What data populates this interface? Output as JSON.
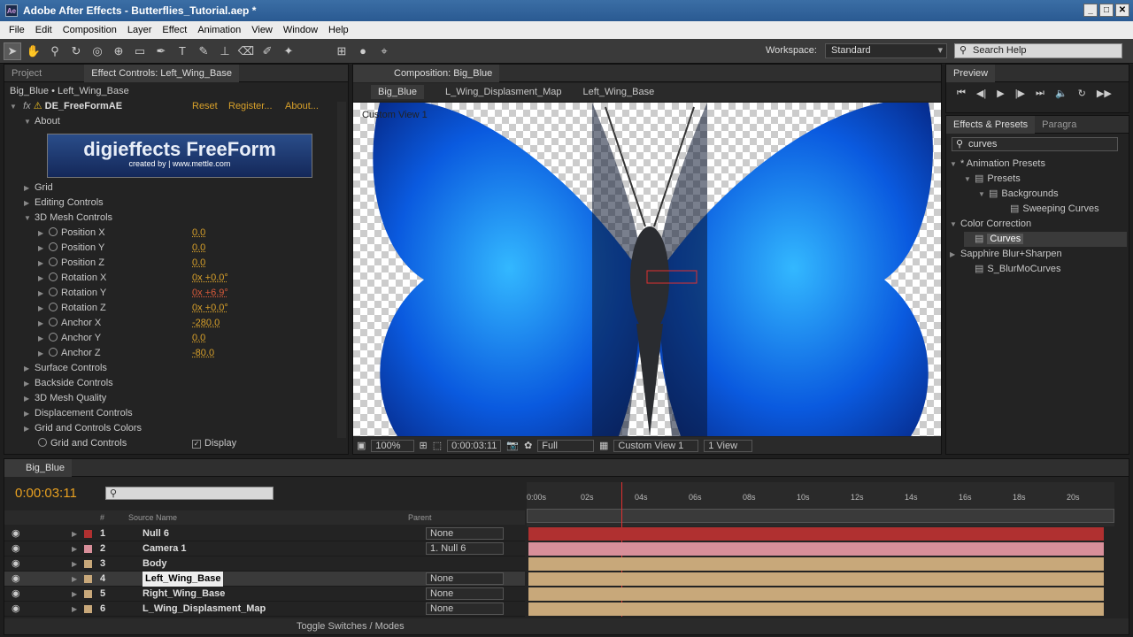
{
  "window": {
    "title": "Adobe After Effects - Butterflies_Tutorial.aep *"
  },
  "menu": [
    "File",
    "Edit",
    "Composition",
    "Layer",
    "Effect",
    "Animation",
    "View",
    "Window",
    "Help"
  ],
  "toolbar": {
    "workspace_label": "Workspace:",
    "workspace_value": "Standard",
    "search_placeholder": "Search Help"
  },
  "left_panel": {
    "tabs": [
      "Project",
      "Effect Controls: Left_Wing_Base"
    ],
    "breadcrumb": "Big_Blue • Left_Wing_Base",
    "effect_name": "DE_FreeFormAE",
    "reset": "Reset",
    "register": "Register...",
    "about_link": "About...",
    "about": "About",
    "banner_title": "digieffects FreeForm",
    "banner_sub": "created by | www.mettle.com",
    "sections": [
      "Grid",
      "Editing Controls",
      "3D Mesh Controls"
    ],
    "params": [
      {
        "name": "Position X",
        "value": "0.0",
        "red": false
      },
      {
        "name": "Position Y",
        "value": "0.0",
        "red": false
      },
      {
        "name": "Position Z",
        "value": "0.0",
        "red": false
      },
      {
        "name": "Rotation X",
        "value": "0x +0.0°",
        "red": false
      },
      {
        "name": "Rotation Y",
        "value": "0x +6.9°",
        "red": true
      },
      {
        "name": "Rotation Z",
        "value": "0x +0.0°",
        "red": false
      },
      {
        "name": "Anchor X",
        "value": "-280.0",
        "red": false
      },
      {
        "name": "Anchor Y",
        "value": "0.0",
        "red": false
      },
      {
        "name": "Anchor Z",
        "value": "-80.0",
        "red": false
      }
    ],
    "sections2": [
      "Surface Controls",
      "Backside Controls",
      "3D Mesh Quality",
      "Displacement Controls",
      "Grid and Controls Colors"
    ],
    "grid_controls": "Grid and Controls",
    "display": "Display"
  },
  "comp": {
    "tab": "Composition: Big_Blue",
    "crumbs": [
      "Big_Blue",
      "L_Wing_Displasment_Map",
      "Left_Wing_Base"
    ],
    "view_label": "Custom View 1",
    "zoom": "100%",
    "time": "0:00:03:11",
    "resolution": "Full",
    "view": "Custom View 1",
    "views": "1 View"
  },
  "preview": {
    "tab": "Preview"
  },
  "effects": {
    "tabs": [
      "Effects & Presets",
      "Paragra"
    ],
    "search": "curves",
    "tree": [
      "* Animation Presets",
      "Presets",
      "Backgrounds",
      "Sweeping Curves",
      "Color Correction",
      "Curves",
      "Sapphire Blur+Sharpen",
      "S_BlurMoCurves"
    ]
  },
  "timeline": {
    "tab": "Big_Blue",
    "time": "0:00:03:11",
    "col_source": "Source Name",
    "col_parent": "Parent",
    "col_num": "#",
    "ruler": [
      "0:00s",
      "02s",
      "04s",
      "06s",
      "08s",
      "10s",
      "12s",
      "14s",
      "16s",
      "18s",
      "20s"
    ],
    "layers": [
      {
        "num": "1",
        "name": "Null 6",
        "parent": "None",
        "color": "#b03030"
      },
      {
        "num": "2",
        "name": "Camera 1",
        "parent": "1. Null 6",
        "color": "#d88f9a"
      },
      {
        "num": "3",
        "name": "Body",
        "parent": "",
        "color": "#c8a87a"
      },
      {
        "num": "4",
        "name": "Left_Wing_Base",
        "parent": "None",
        "color": "#c8a87a"
      },
      {
        "num": "5",
        "name": "Right_Wing_Base",
        "parent": "None",
        "color": "#c8a87a"
      },
      {
        "num": "6",
        "name": "L_Wing_Displasment_Map",
        "parent": "None",
        "color": "#c8a87a"
      }
    ],
    "toggle": "Toggle Switches / Modes"
  }
}
